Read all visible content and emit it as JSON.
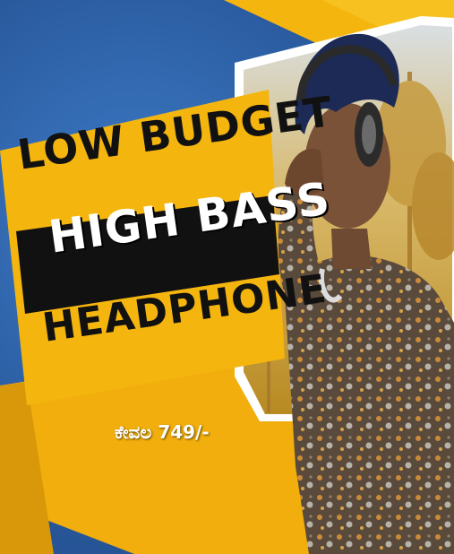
{
  "thumbnail": {
    "headline": {
      "line1": "LOW BUDGET",
      "line2": "HIGH BASS",
      "line3": "HEADPHONE"
    },
    "price_label": "ಕೇವಲ 749/-"
  },
  "colors": {
    "background_blue": "#2f63a8",
    "accent_yellow": "#f5b50f",
    "panel_black": "#111111",
    "text_white": "#ffffff"
  },
  "icons": [
    "headphones-icon"
  ]
}
